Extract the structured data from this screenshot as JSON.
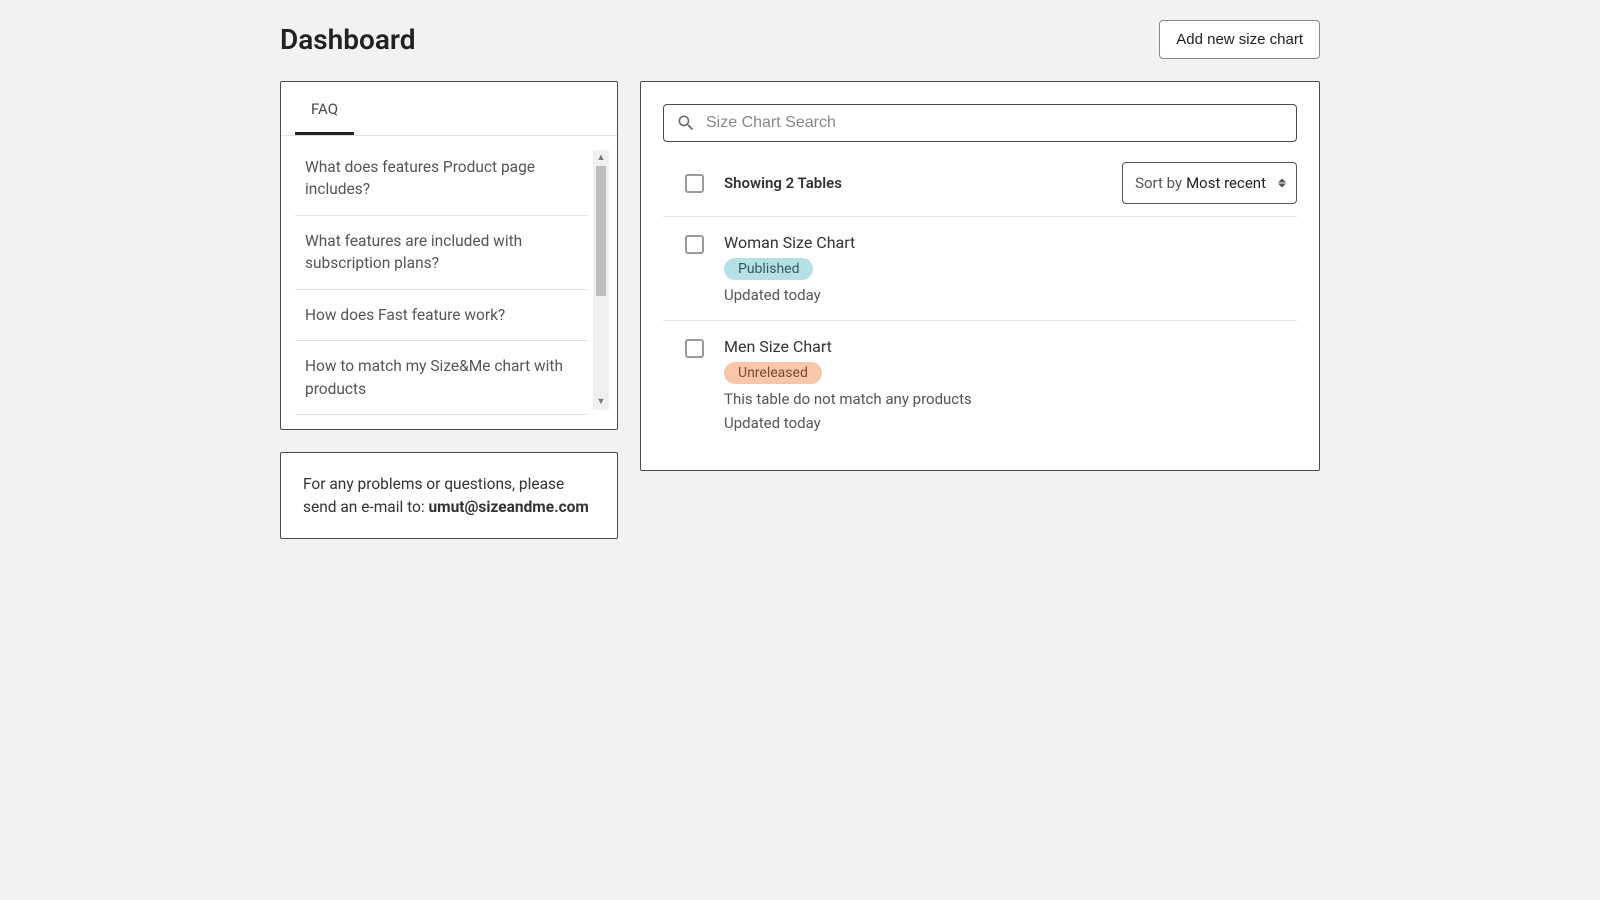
{
  "header": {
    "title": "Dashboard",
    "add_button": "Add new size chart"
  },
  "faq": {
    "tab_label": "FAQ",
    "items": [
      "What does features Product page includes?",
      "What features are included with subscription plans?",
      "How does Fast feature work?",
      "How to match my Size&Me chart with products"
    ]
  },
  "support": {
    "text": "For any problems or questions, please send an e-mail to: ",
    "email": "umut@sizeandme.com"
  },
  "main": {
    "search_placeholder": "Size Chart Search",
    "showing_text": "Showing 2 Tables",
    "sort_label": "Sort by ",
    "sort_value": "Most recent",
    "rows": [
      {
        "title": "Woman Size Chart",
        "badge": "Published",
        "badge_type": "published",
        "warning": "",
        "updated": "Updated today"
      },
      {
        "title": "Men Size Chart",
        "badge": "Unreleased",
        "badge_type": "unreleased",
        "warning": "This table do not match any products",
        "updated": "Updated today"
      }
    ]
  }
}
